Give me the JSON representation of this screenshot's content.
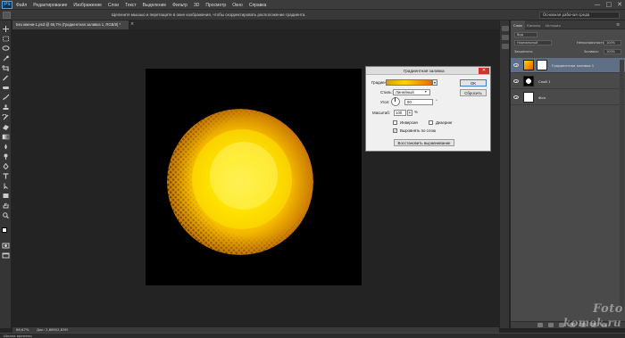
{
  "app": {
    "logo": "Ps",
    "menu": [
      "Файл",
      "Редактирование",
      "Изображение",
      "Слои",
      "Текст",
      "Выделение",
      "Фильтр",
      "3D",
      "Просмотр",
      "Окно",
      "Справка"
    ],
    "window_controls": [
      "—",
      "□",
      "✕"
    ]
  },
  "options_bar": {
    "hint": "Щелкните мышью и перетащите в окне изображения, чтобы скорректировать расположение градиента.",
    "workspace": "Основная рабочая среда"
  },
  "document": {
    "tab_title": "Без имени-1.psd @ 66,7% (Градиентная заливка 1, RGB/8) *",
    "close": "×",
    "fg_color": "#ffffff",
    "bg_color": "#000000"
  },
  "status": {
    "zoom": "66,67%",
    "doc_size": "Док: 2,86M/2,83M",
    "timeline": "Шкала времени"
  },
  "dialog": {
    "title": "Градиентная заливка",
    "close": "✕",
    "gradient_label": "Градиент:",
    "gradient_colors": [
      "#d7a000",
      "#ffd500",
      "#f06a00"
    ],
    "style_label": "Стиль:",
    "style_value": "Линейный",
    "angle_label": "Угол:",
    "angle_value": "90",
    "angle_unit": "°",
    "scale_label": "Масштаб:",
    "scale_value": "100",
    "scale_unit": "%",
    "reverse_label": "Инверсия",
    "dither_label": "Дизеринг",
    "align_label": "Выровнять по слою",
    "align_checked": "✓",
    "realign_button": "Восстановить выравнивание",
    "ok_button": "OK",
    "reset_button": "Сбросить"
  },
  "layers_panel": {
    "tabs": [
      "Слои",
      "Каналы",
      "История"
    ],
    "menu": "≡",
    "filter_label": "Вид",
    "blend_mode": "Нормальный",
    "opacity_label": "Непрозрачность:",
    "opacity_value": "100%",
    "lock_label": "Закрепить:",
    "fill_label": "Заливка:",
    "fill_value": "100%",
    "layers": [
      {
        "name": "Градиентная заливка 1",
        "selected": true
      },
      {
        "name": "Слой 1",
        "selected": false
      },
      {
        "name": "Фон",
        "selected": false
      }
    ]
  },
  "watermark": {
    "line1": "Foto",
    "line2": "komok.ru"
  }
}
